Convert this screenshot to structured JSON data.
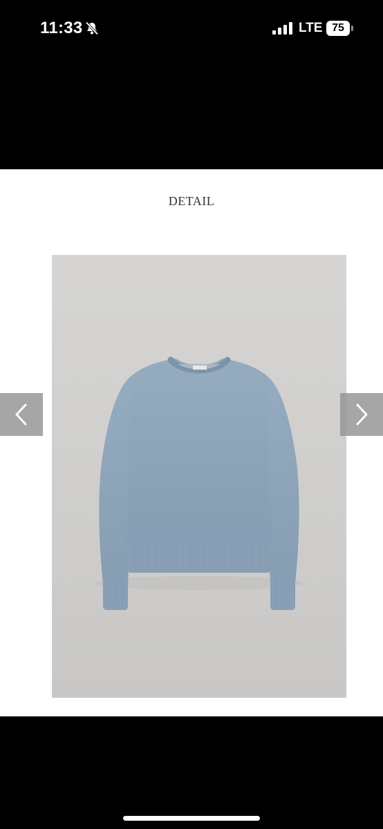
{
  "status_bar": {
    "time": "11:33",
    "silent_icon": "bell-slash-icon",
    "signal_icon": "cellular-signal-icon",
    "network": "LTE",
    "battery_level": "75"
  },
  "page": {
    "section_title": "DETAIL",
    "photo_subject": "sweater-photo",
    "prev_icon": "chevron-left-icon",
    "next_icon": "chevron-right-icon"
  },
  "colors": {
    "background": "#000000",
    "content_background": "#ffffff",
    "sweater": "#8fa6bc",
    "photo_background": "#d2d1cf"
  }
}
